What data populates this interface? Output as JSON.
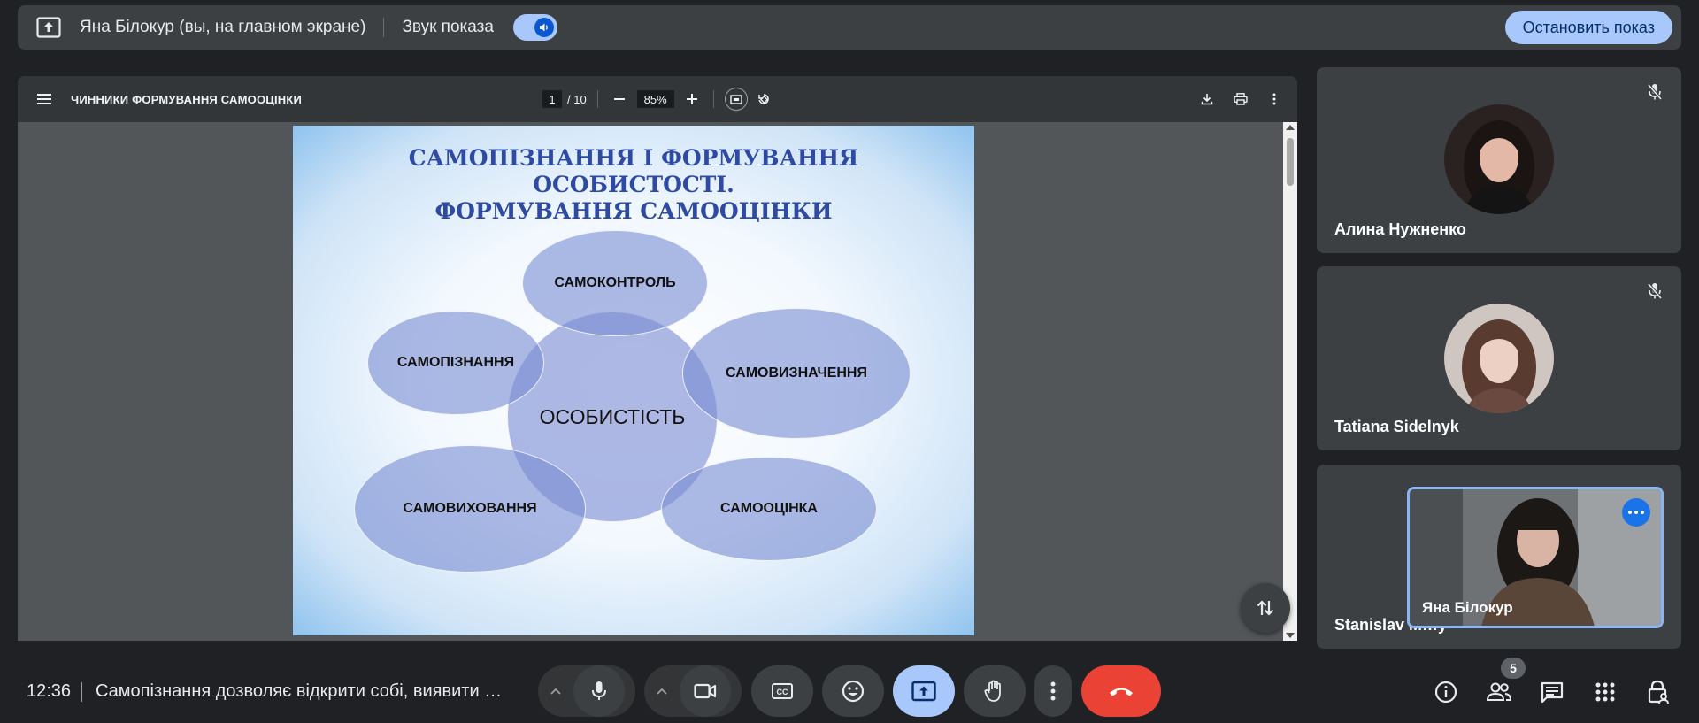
{
  "banner": {
    "title": "Яна Білокур (вы, на главном экране)",
    "sound_label": "Звук показа",
    "sound_enabled": true,
    "stop_label": "Остановить показ"
  },
  "pdf": {
    "document_title": "ЧИННИКИ ФОРМУВАННЯ САМООЦІНКИ",
    "page_current": "1",
    "page_total": "/ 10",
    "zoom": "85%"
  },
  "slide": {
    "title_lines": [
      "САМОПІЗНАННЯ І ФОРМУВАННЯ",
      "ОСОБИСТОСТІ.",
      "ФОРМУВАННЯ САМООЦІНКИ"
    ],
    "center": "ОСОБИСТІСТЬ",
    "nodes": [
      "САМОКОНТРОЛЬ",
      "САМОПІЗНАННЯ",
      "САМОВИЗНАЧЕННЯ",
      "САМОВИХОВАННЯ",
      "САМООЦІНКА"
    ]
  },
  "participants": [
    {
      "name": "Алина Нужненко",
      "muted": true
    },
    {
      "name": "Tatiana Sidelnyk",
      "muted": true
    },
    {
      "name": "Stanislav M…y",
      "muted": false
    }
  ],
  "self_view": {
    "name": "Яна Білокур"
  },
  "bottom": {
    "time": "12:36",
    "meeting_title": "Самопізнання дозволяє відкрити собі, виявити …",
    "people_count": "5"
  },
  "colors": {
    "background": "#202124",
    "accent": "#a8c7fa",
    "hangup": "#ea4335",
    "slide_title": "#2e4aa3"
  }
}
